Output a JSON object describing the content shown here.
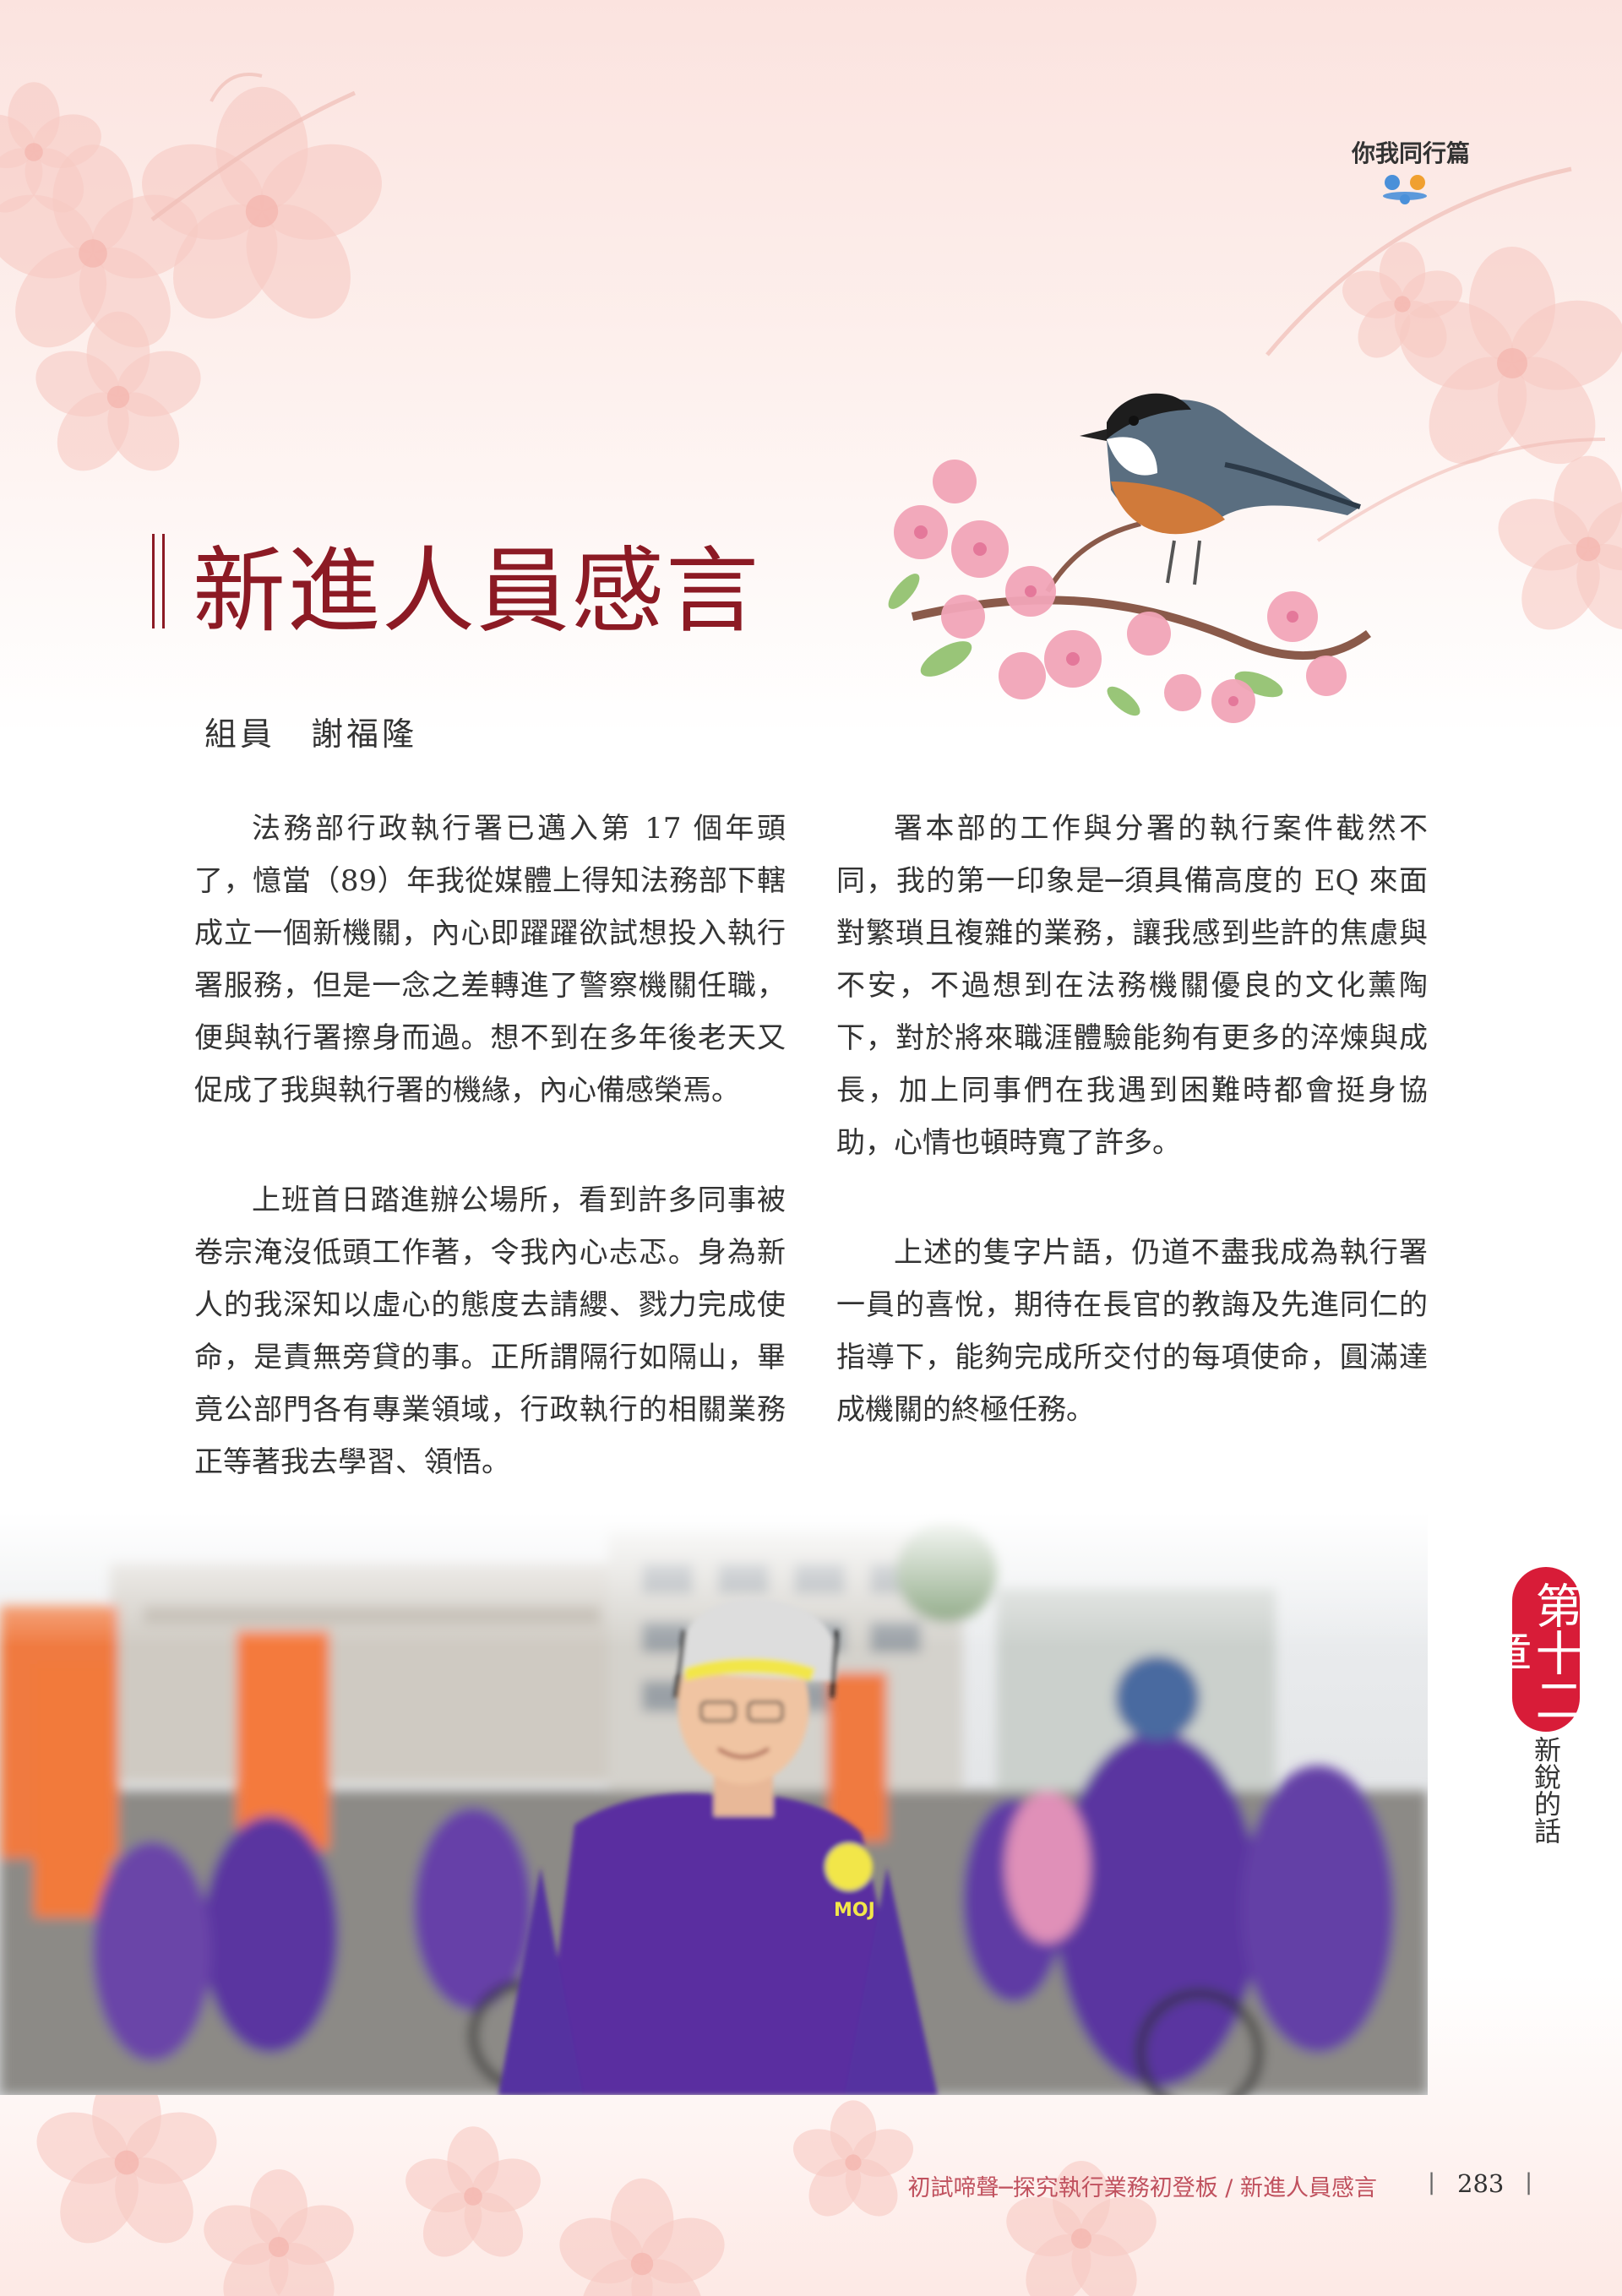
{
  "header": {
    "section_label": "你我同行篇"
  },
  "article": {
    "title": "新進人員感言",
    "author": "組員　謝福隆",
    "left_column": [
      "法務部行政執行署已邁入第 17 個年頭了，憶當（89）年我從媒體上得知法務部下轄成立一個新機關，內心即躍躍欲試想投入執行署服務，但是一念之差轉進了警察機關任職，便與執行署擦身而過。想不到在多年後老天又促成了我與執行署的機緣，內心備感榮焉。",
      "上班首日踏進辦公場所，看到許多同事被卷宗淹沒低頭工作著，令我內心忐忑。身為新人的我深知以虛心的態度去請纓、戮力完成使命，是責無旁貸的事。正所謂隔行如隔山，畢竟公部門各有專業領域，行政執行的相關業務正等著我去學習、領悟。"
    ],
    "right_column": [
      "署本部的工作與分署的執行案件截然不同，我的第一印象是─須具備高度的 EQ 來面對繁瑣且複雜的業務，讓我感到些許的焦慮與不安，不過想到在法務機關優良的文化薰陶下，對於將來職涯體驗能夠有更多的淬煉與成長，加上同事們在我遇到困難時都會挺身協助，心情也頓時寬了許多。",
      "上述的隻字片語，仍道不盡我成為執行署一員的喜悅，期待在長官的教誨及先進同仁的指導下，能夠完成所交付的每項使命，圓滿達成機關的終極任務。"
    ]
  },
  "photo": {
    "shirt_logo_text": "MOJ"
  },
  "chapter_tab": {
    "chapter": "第十二章",
    "subtitle": "新銳的話"
  },
  "footer": {
    "text": "初試啼聲─探究執行業務初登板 / 新進人員感言",
    "separator": "|",
    "page_number": "283"
  },
  "colors": {
    "title": "#8c1a24",
    "chapter_tab": "#d81c38",
    "footer_text": "#c0515e",
    "shirt": "#5a2fa0"
  }
}
